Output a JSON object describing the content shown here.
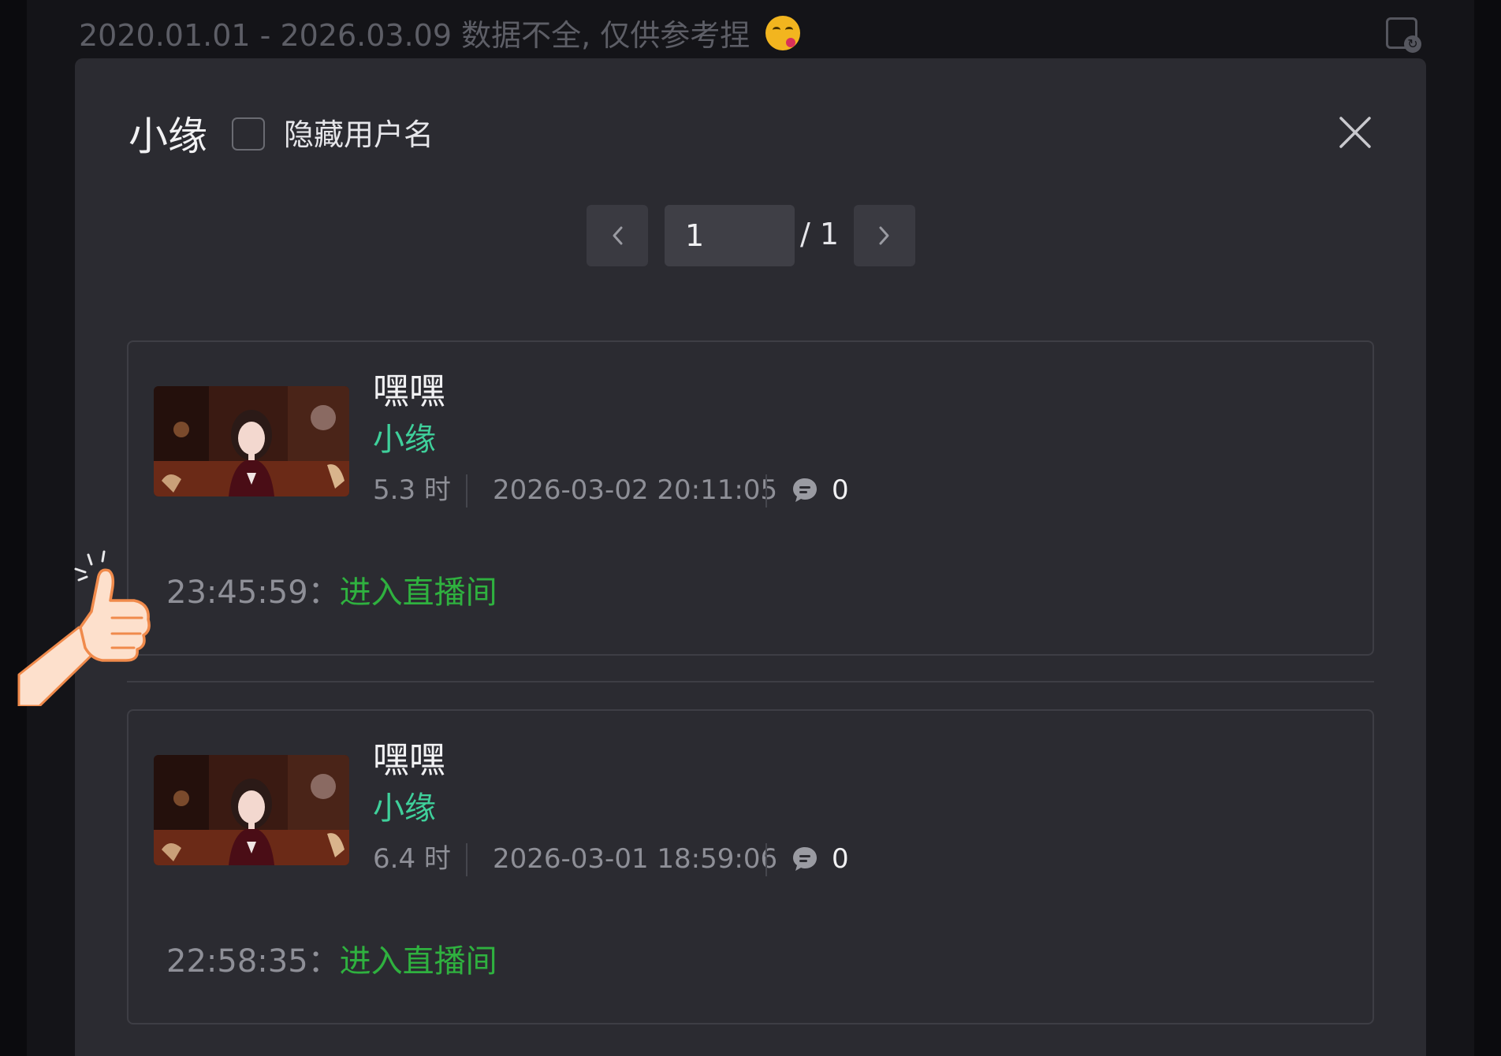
{
  "header": {
    "note": "2020.01.01 - 2026.03.09 数据不全, 仅供参考捏"
  },
  "modal": {
    "title": "小缘",
    "hide_username_label": "隐藏用户名",
    "pager": {
      "current": "1",
      "total_text": "/ 1"
    }
  },
  "records": [
    {
      "title": "嘿嘿",
      "streamer": "小缘",
      "duration": "5.3 时",
      "datetime": "2026-03-02 20:11:05",
      "comments": "0",
      "log_time": "23:45:59：",
      "log_action": "进入直播间"
    },
    {
      "title": "嘿嘿",
      "streamer": "小缘",
      "duration": "6.4 时",
      "datetime": "2026-03-01 18:59:06",
      "comments": "0",
      "log_time": "22:58:35：",
      "log_action": "进入直播间"
    }
  ],
  "icons": {
    "emoji": "face-savoring-food-emoji",
    "share": "share-icon",
    "close": "close-icon",
    "prev": "chevron-left-icon",
    "next": "chevron-right-icon",
    "comment": "comment-icon",
    "thumbs_up": "thumbs-up-icon"
  },
  "colors": {
    "modal_bg": "#2b2b31",
    "accent_green": "#3fd09b",
    "link_green": "#2fb13f"
  }
}
